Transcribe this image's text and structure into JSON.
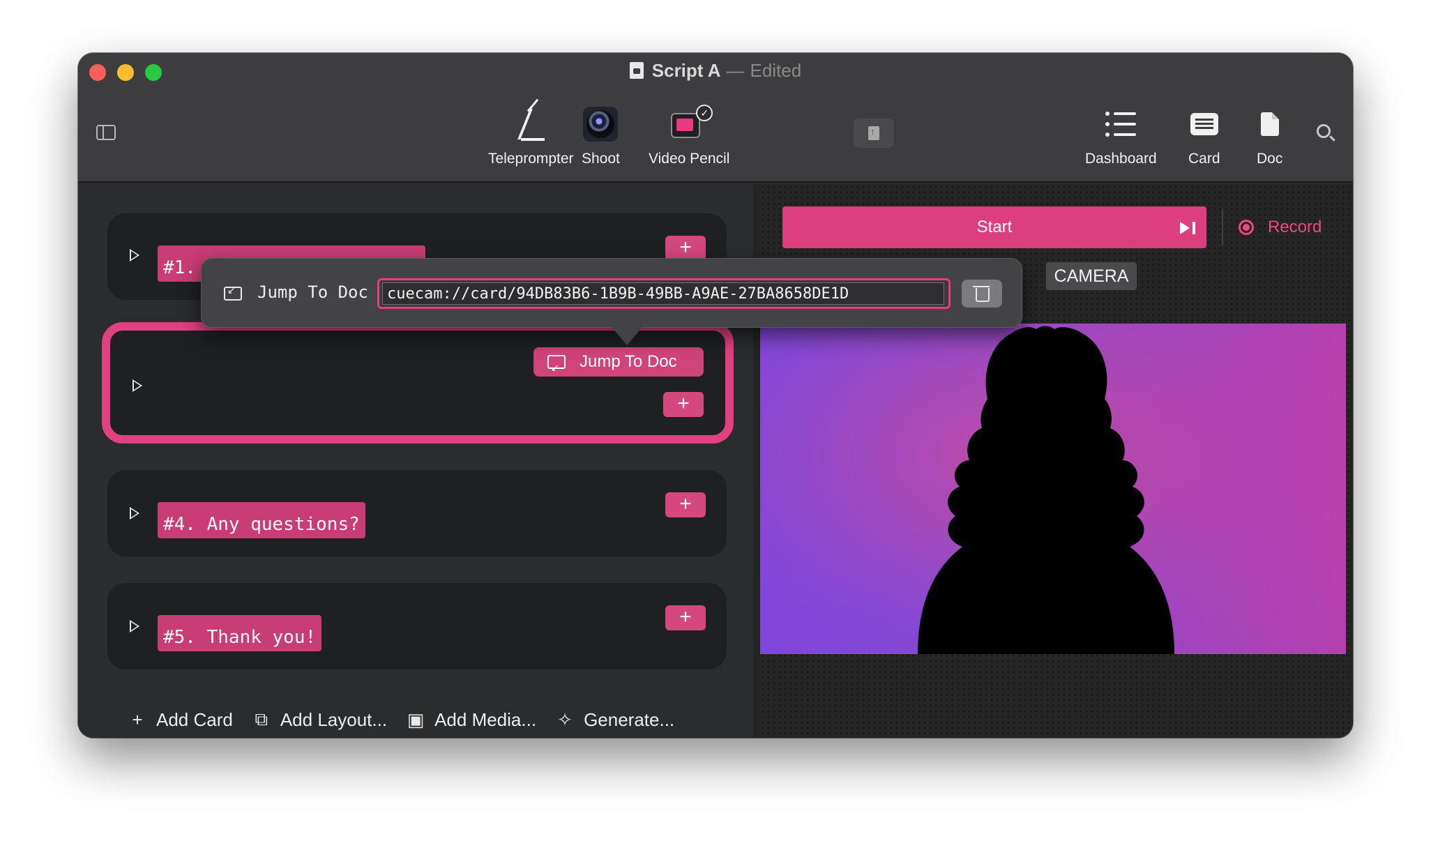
{
  "window": {
    "title": "Script A",
    "title_separator": "—",
    "title_status": "Edited"
  },
  "toolbar": {
    "teleprompter_label": "Teleprompter",
    "shoot_label": "Shoot",
    "video_pencil_label": "Video Pencil",
    "dashboard_label": "Dashboard",
    "card_label": "Card",
    "doc_label": "Doc"
  },
  "cards": [
    {
      "title": "#1.",
      "plus": "+"
    },
    {
      "title": "",
      "plus": "+",
      "jump_label": "Jump To Doc"
    },
    {
      "title": "#4. Any questions?",
      "plus": "+"
    },
    {
      "title": "#5. Thank you!",
      "plus": "+"
    }
  ],
  "bottom_bar": {
    "add_card": "Add Card",
    "add_layout": "Add Layout...",
    "add_media": "Add Media...",
    "generate": "Generate..."
  },
  "right_pane": {
    "start_label": "Start",
    "record_label": "Record",
    "camera_tag": "CAMERA"
  },
  "popover": {
    "label": "Jump To Doc",
    "url_value": "cuecam://card/94DB83B6-1B9B-49BB-A9AE-27BA8658DE1D"
  },
  "colors": {
    "accent": "#e2417f",
    "record": "#f0487d",
    "window_bg": "#2b2c2e"
  },
  "icons": {
    "sidebar_toggle": "sidebar-icon",
    "teleprompter": "teleprompter-icon",
    "shoot": "camera-lens-icon",
    "video_pencil": "video-pencil-icon",
    "dashboard": "list-icon",
    "card": "card-icon",
    "doc": "doc-icon",
    "search": "search-icon",
    "trash": "trash-icon"
  }
}
